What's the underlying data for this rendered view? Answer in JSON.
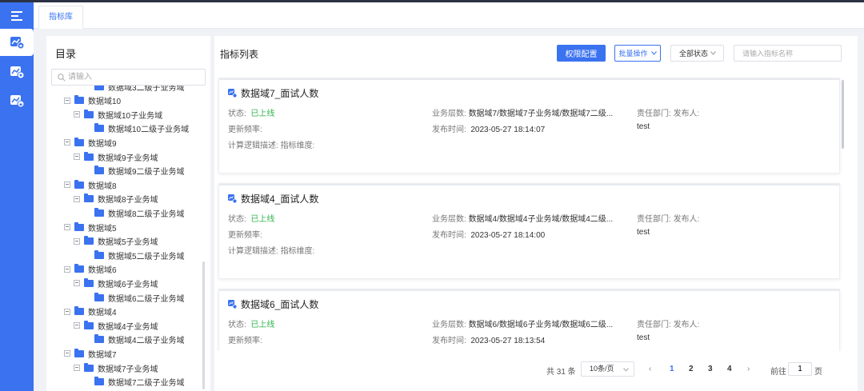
{
  "nav": {
    "icons": [
      "menu-icon",
      "metric-library-icon",
      "metric-data-icon",
      "metric-lock-icon"
    ]
  },
  "tabs": [
    {
      "label": "指标库"
    }
  ],
  "sidebar": {
    "title": "目录",
    "search_placeholder": "请输入",
    "tree": [
      {
        "label": "数据域3二级子业务域",
        "level": 2
      },
      {
        "label": "数据域10",
        "level": 0
      },
      {
        "label": "数据域10子业务域",
        "level": 1
      },
      {
        "label": "数据域10二级子业务域",
        "level": 2
      },
      {
        "label": "数据域9",
        "level": 0
      },
      {
        "label": "数据域9子业务域",
        "level": 1
      },
      {
        "label": "数据域9二级子业务域",
        "level": 2
      },
      {
        "label": "数据域8",
        "level": 0
      },
      {
        "label": "数据域8子业务域",
        "level": 1
      },
      {
        "label": "数据域8二级子业务域",
        "level": 2
      },
      {
        "label": "数据域5",
        "level": 0
      },
      {
        "label": "数据域5子业务域",
        "level": 1
      },
      {
        "label": "数据域5二级子业务域",
        "level": 2
      },
      {
        "label": "数据域6",
        "level": 0
      },
      {
        "label": "数据域6子业务域",
        "level": 1
      },
      {
        "label": "数据域6二级子业务域",
        "level": 2
      },
      {
        "label": "数据域4",
        "level": 0
      },
      {
        "label": "数据域4子业务域",
        "level": 1
      },
      {
        "label": "数据域4二级子业务域",
        "level": 2
      },
      {
        "label": "数据域7",
        "level": 0
      },
      {
        "label": "数据域7子业务域",
        "level": 1
      },
      {
        "label": "数据域7二级子业务域",
        "level": 2
      }
    ]
  },
  "main": {
    "title": "指标列表",
    "perm_button": "权限配置",
    "batch_button": "批量操作",
    "status_select": "全部状态",
    "search_placeholder": "请输入指标名称",
    "labels": {
      "status": "状态:",
      "hierarchy": "业务层数:",
      "dept": "责任部门:",
      "publisher": "发布人:",
      "frequency": "更新频率:",
      "publish_time": "发布时间:",
      "logic": "计算逻辑描述:",
      "dimension": "指标维度:"
    },
    "cards": [
      {
        "title": "数据域7_面试人数",
        "status": "已上线",
        "hierarchy": "数据域7/数据域7子业务域/数据域7二级...",
        "publish_time": "2023-05-27 18:14:07",
        "publisher_value": "test"
      },
      {
        "title": "数据域4_面试人数",
        "status": "已上线",
        "hierarchy": "数据域4/数据域4子业务域/数据域4二级...",
        "publish_time": "2023-05-27 18:14:00",
        "publisher_value": "test"
      },
      {
        "title": "数据域6_面试人数",
        "status": "已上线",
        "hierarchy": "数据域6/数据域6子业务域/数据域6二级...",
        "publish_time": "2023-05-27 18:13:54",
        "publisher_value": "test"
      }
    ]
  },
  "pagination": {
    "total": "共 31 条",
    "page_size": "10条/页",
    "pages": [
      "1",
      "2",
      "3",
      "4"
    ],
    "current": "1",
    "goto_label": "前往",
    "goto_value": "1",
    "goto_unit": "页"
  },
  "colors": {
    "primary": "#3a72f0",
    "online": "#2eb34a",
    "nav_bg": "#3a72f0"
  }
}
